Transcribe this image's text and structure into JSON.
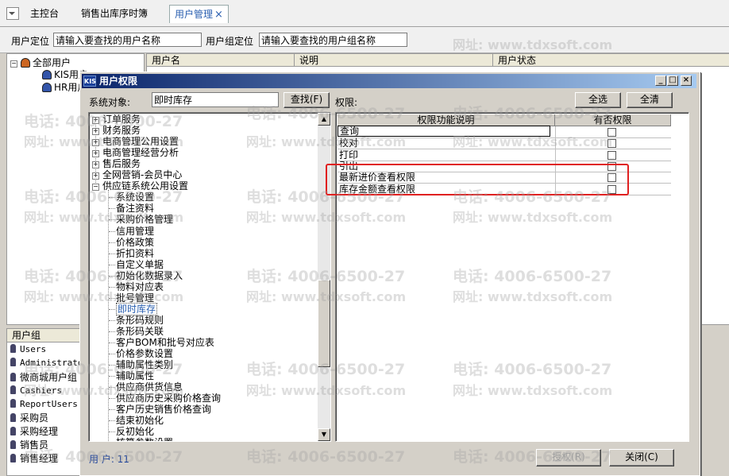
{
  "tabs": [
    {
      "label": "主控台"
    },
    {
      "label": "销售出库序时簿"
    },
    {
      "label": "用户管理",
      "close": "×"
    }
  ],
  "locator": {
    "user_label": "用户定位",
    "user_placeholder": "请输入要查找的用户名称",
    "group_label": "用户组定位",
    "group_placeholder": "请输入要查找的用户组名称"
  },
  "left_tree": {
    "root": "全部用户",
    "items": [
      "KIS用户",
      "HR用户"
    ]
  },
  "user_grid": {
    "columns": [
      "用户名",
      "说明",
      "用户状态"
    ]
  },
  "groups": {
    "header": "用户组",
    "items": [
      "Users",
      "Administrato",
      "微商城用户组",
      "Cashiers",
      "ReportUsers",
      "采购员",
      "采购经理",
      "销售员",
      "销售经理"
    ]
  },
  "dialog": {
    "logo": "KIS",
    "title": "用户权限",
    "object_label": "系统对象:",
    "object_value": "即时库存",
    "find_button": "查找(F)",
    "perm_label": "权限:",
    "select_all": "全选",
    "clear_all": "全清",
    "perm_columns": [
      "权限功能说明",
      "有否权限"
    ],
    "perms": [
      {
        "name": "查询",
        "checked": false
      },
      {
        "name": "校对",
        "checked": false
      },
      {
        "name": "打印",
        "checked": false
      },
      {
        "name": "引出",
        "checked": false
      },
      {
        "name": "最新进价查看权限",
        "checked": false
      },
      {
        "name": "库存金额查看权限",
        "checked": false
      }
    ],
    "tree_top": [
      "订单服务",
      "财务服务",
      "电商管理公用设置",
      "电商管理经营分析",
      "售后服务",
      "全网营销-会员中心",
      "供应链系统公用设置"
    ],
    "tree_children": [
      "系统设置",
      "备注资料",
      "采购价格管理",
      "信用管理",
      "价格政策",
      "折扣资料",
      "自定义单据",
      "初始化数据录入",
      "物料对应表",
      "批号管理",
      "即时库存",
      "条形码规则",
      "条形码关联",
      "客户BOM和批号对应表",
      "价格参数设置",
      "辅助属性类别",
      "辅助属性",
      "供应商供货信息",
      "供应商历史采购价格查询",
      "客户历史销售价格查询",
      "结束初始化",
      "反初始化",
      "核算参数设置"
    ],
    "selected": "即时库存",
    "status": "用 户: 11",
    "authorize_button": "授权(R)",
    "close_button": "关闭(C)"
  },
  "watermark": {
    "phone": "电话: 4006-6500-27",
    "site": "网址: www.tdxsoft.com"
  }
}
